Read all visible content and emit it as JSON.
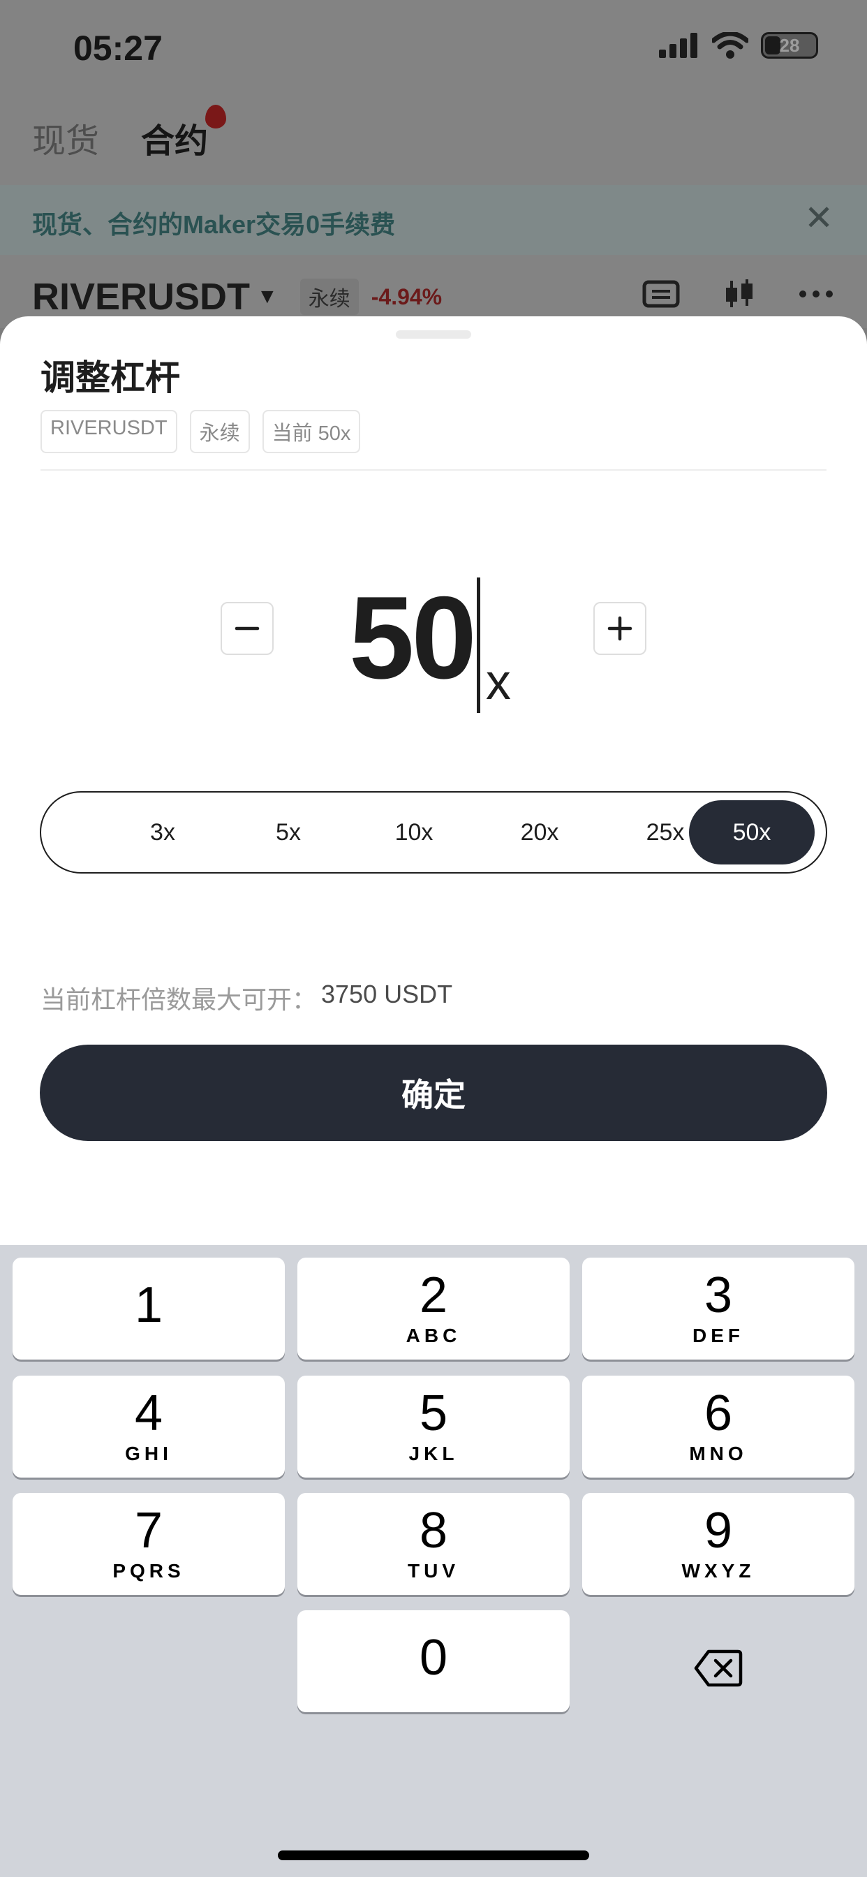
{
  "status_bar": {
    "time": "05:27",
    "battery": "28"
  },
  "background_app": {
    "tabs": [
      {
        "label": "现货"
      },
      {
        "label": "合约"
      }
    ],
    "banner": {
      "text": "现货、合约的Maker交易0手续费"
    },
    "ticker": {
      "symbol": "RIVERUSDT",
      "type_tag": "永续",
      "change": "-4.94%"
    }
  },
  "sheet": {
    "title": "调整杠杆",
    "tags": [
      {
        "label": "RIVERUSDT"
      },
      {
        "label": "永续"
      },
      {
        "label": "当前 50x"
      }
    ],
    "leverage": {
      "value": "50",
      "unit": "x"
    },
    "presets": [
      {
        "label": "3x"
      },
      {
        "label": "5x"
      },
      {
        "label": "10x"
      },
      {
        "label": "20x"
      },
      {
        "label": "25x"
      },
      {
        "label": "50x"
      }
    ],
    "selected_preset": "50x",
    "max_open": {
      "label": "当前杠杆倍数最大可开：",
      "value": "3750 USDT"
    },
    "confirm_label": "确定"
  },
  "keyboard": {
    "keys": [
      {
        "digit": "1",
        "letters": ""
      },
      {
        "digit": "2",
        "letters": "ABC"
      },
      {
        "digit": "3",
        "letters": "DEF"
      },
      {
        "digit": "4",
        "letters": "GHI"
      },
      {
        "digit": "5",
        "letters": "JKL"
      },
      {
        "digit": "6",
        "letters": "MNO"
      },
      {
        "digit": "7",
        "letters": "PQRS"
      },
      {
        "digit": "8",
        "letters": "TUV"
      },
      {
        "digit": "9",
        "letters": "WXYZ"
      },
      {
        "digit": "0",
        "letters": ""
      }
    ]
  },
  "colors": {
    "primary_dark": "#262b36",
    "negative": "#c4303a",
    "overlay": "#838383"
  }
}
